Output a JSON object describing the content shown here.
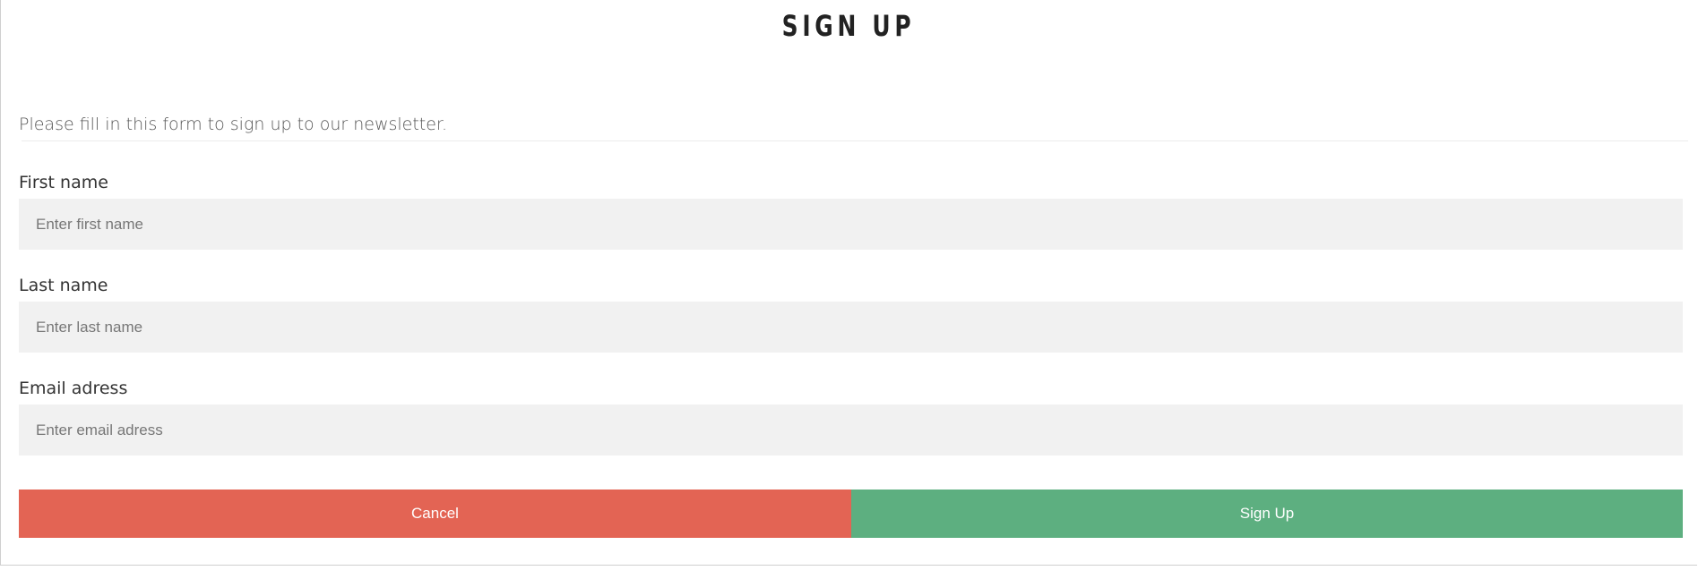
{
  "form": {
    "title": "SIGN UP",
    "subtitle": "Please fill in this form to sign up to our newsletter.",
    "first_name": {
      "label": "First name",
      "value": "",
      "placeholder": "Enter first name"
    },
    "last_name": {
      "label": "Last name",
      "value": "",
      "placeholder": "Enter last name"
    },
    "email": {
      "label": "Email adress",
      "value": "",
      "placeholder": "Enter email adress"
    },
    "buttons": {
      "cancel_label": "Cancel",
      "signup_label": "Sign Up"
    }
  },
  "colors": {
    "cancel": "#e36454",
    "signup": "#5daf80",
    "input_background": "#f1f1f1"
  }
}
